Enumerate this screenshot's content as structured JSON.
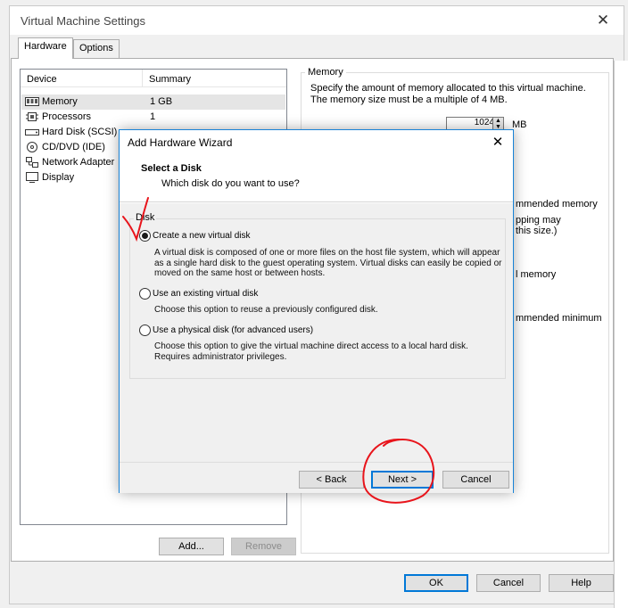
{
  "window": {
    "title": "Virtual Machine Settings",
    "close_glyph": "✕"
  },
  "tabs": [
    {
      "label": "Hardware",
      "active": true
    },
    {
      "label": "Options",
      "active": false
    }
  ],
  "device_list": {
    "columns": [
      "Device",
      "Summary"
    ],
    "rows": [
      {
        "device": "Memory",
        "summary": "1 GB",
        "icon": "memory-icon",
        "selected": true
      },
      {
        "device": "Processors",
        "summary": "1",
        "icon": "processor-icon"
      },
      {
        "device": "Hard Disk (SCSI)",
        "summary": "",
        "icon": "hard-disk-icon"
      },
      {
        "device": "CD/DVD (IDE)",
        "summary": "",
        "icon": "cd-dvd-icon"
      },
      {
        "device": "Network Adapter",
        "summary": "",
        "icon": "network-adapter-icon"
      },
      {
        "device": "Display",
        "summary": "",
        "icon": "display-icon"
      }
    ]
  },
  "list_buttons": {
    "add": "Add...",
    "remove": "Remove"
  },
  "memory_panel": {
    "legend": "Memory",
    "description": "Specify the amount of memory allocated to this virtual machine. The memory size must be a multiple of 4 MB.",
    "value": "1024",
    "unit": "MB",
    "partial_1": "mmended memory",
    "partial_2": "pping may",
    "partial_3": "this size.)",
    "partial_4": "l memory",
    "partial_5": "mmended minimum"
  },
  "footer_buttons": {
    "ok": "OK",
    "cancel": "Cancel",
    "help": "Help"
  },
  "wizard": {
    "title": "Add Hardware Wizard",
    "close_glyph": "✕",
    "heading": "Select a Disk",
    "subheading": "Which disk do you want to use?",
    "group_label": "Disk",
    "options": [
      {
        "label": "Create a new virtual disk",
        "selected": true,
        "description": "A virtual disk is composed of one or more files on the host file system, which will appear as a single hard disk to the guest operating system. Virtual disks can easily be copied or moved on the same host or between hosts."
      },
      {
        "label": "Use an existing virtual disk",
        "selected": false,
        "description": "Choose this option to reuse a previously configured disk."
      },
      {
        "label": "Use a physical disk (for advanced users)",
        "selected": false,
        "description": "Choose this option to give the virtual machine direct access to a local hard disk. Requires administrator privileges."
      }
    ],
    "buttons": {
      "back": "< Back",
      "next": "Next >",
      "cancel": "Cancel"
    }
  },
  "colors": {
    "accent": "#0078d7",
    "annotation": "#e8141b"
  }
}
